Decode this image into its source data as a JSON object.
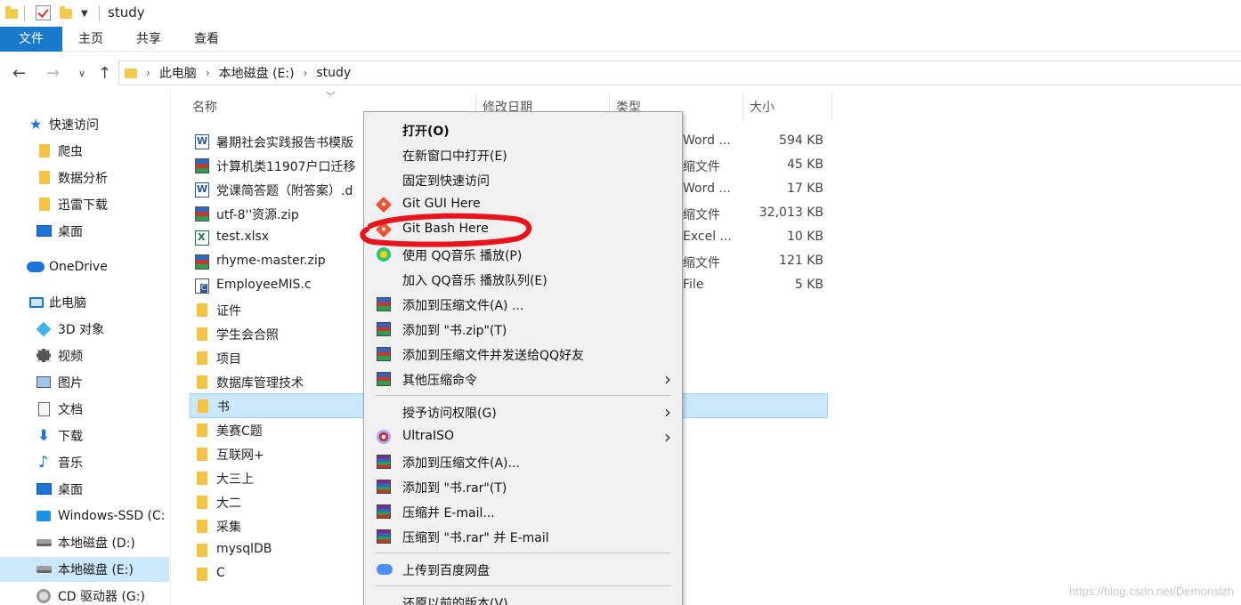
{
  "window": {
    "title": "study"
  },
  "ribbon": {
    "tabs": [
      "文件",
      "主页",
      "共享",
      "查看"
    ]
  },
  "address": {
    "crumbs": [
      "此电脑",
      "本地磁盘 (E:)",
      "study"
    ]
  },
  "sidebar": {
    "items": [
      {
        "label": "快速访问",
        "icon": "star-icon"
      },
      {
        "label": "爬虫",
        "icon": "folder-icon"
      },
      {
        "label": "数据分析",
        "icon": "folder-icon"
      },
      {
        "label": "迅雷下载",
        "icon": "folder-icon"
      },
      {
        "label": "桌面",
        "icon": "desktop-icon"
      },
      {
        "label": "OneDrive",
        "icon": "cloud-icon"
      },
      {
        "label": "此电脑",
        "icon": "computer-icon"
      },
      {
        "label": "3D 对象",
        "icon": "cube-icon"
      },
      {
        "label": "视频",
        "icon": "video-icon"
      },
      {
        "label": "图片",
        "icon": "picture-icon"
      },
      {
        "label": "文档",
        "icon": "document-icon"
      },
      {
        "label": "下载",
        "icon": "download-icon"
      },
      {
        "label": "音乐",
        "icon": "music-icon"
      },
      {
        "label": "桌面",
        "icon": "desktop-icon"
      },
      {
        "label": "Windows-SSD (C:",
        "icon": "windows-drive-icon"
      },
      {
        "label": "本地磁盘 (D:)",
        "icon": "drive-icon"
      },
      {
        "label": "本地磁盘 (E:)",
        "icon": "drive-icon"
      },
      {
        "label": "CD 驱动器 (G:)",
        "icon": "cd-drive-icon"
      }
    ]
  },
  "columns": [
    "名称",
    "修改日期",
    "类型",
    "大小"
  ],
  "files": [
    {
      "name": "暑期社会实践报告书模版",
      "type": "Word ...",
      "size": "594 KB",
      "icon": "word-icon"
    },
    {
      "name": "计算机类11907户口迁移",
      "type": "缩文件",
      "size": "45 KB",
      "icon": "zip-icon"
    },
    {
      "name": "党课简答题（附答案）.d",
      "type": "Word ...",
      "size": "17 KB",
      "icon": "word-icon"
    },
    {
      "name": "utf-8''资源.zip",
      "type": "缩文件",
      "size": "32,013 KB",
      "icon": "zip-icon"
    },
    {
      "name": "test.xlsx",
      "type": "Excel ...",
      "size": "10 KB",
      "icon": "excel-icon"
    },
    {
      "name": "rhyme-master.zip",
      "type": "缩文件",
      "size": "121 KB",
      "icon": "zip-icon"
    },
    {
      "name": "EmployeeMIS.c",
      "type": "File",
      "size": "5 KB",
      "icon": "c-file-icon"
    },
    {
      "name": "证件",
      "type": "",
      "size": "",
      "icon": "folder-icon"
    },
    {
      "name": "学生会合照",
      "type": "",
      "size": "",
      "icon": "folder-icon"
    },
    {
      "name": "项目",
      "type": "",
      "size": "",
      "icon": "folder-icon"
    },
    {
      "name": "数据库管理技术",
      "type": "",
      "size": "",
      "icon": "folder-icon"
    },
    {
      "name": "书",
      "type": "",
      "size": "",
      "icon": "folder-icon"
    },
    {
      "name": "美赛C题",
      "type": "",
      "size": "",
      "icon": "folder-icon"
    },
    {
      "name": "互联网+",
      "type": "",
      "size": "",
      "icon": "folder-icon"
    },
    {
      "name": "大三上",
      "type": "",
      "size": "",
      "icon": "folder-icon"
    },
    {
      "name": "大二",
      "type": "",
      "size": "",
      "icon": "folder-icon"
    },
    {
      "name": "采集",
      "type": "",
      "size": "",
      "icon": "folder-icon"
    },
    {
      "name": "mysqlDB",
      "type": "",
      "size": "",
      "icon": "folder-icon"
    },
    {
      "name": "C",
      "type": "",
      "size": "",
      "icon": "folder-icon"
    }
  ],
  "context_menu": {
    "items": [
      {
        "label": "打开(O)",
        "icon": "",
        "bold": true,
        "submenu": false
      },
      {
        "label": "在新窗口中打开(E)",
        "icon": "",
        "submenu": false
      },
      {
        "label": "固定到快速访问",
        "icon": "",
        "submenu": false
      },
      {
        "label": "Git GUI Here",
        "icon": "git-icon",
        "submenu": false
      },
      {
        "label": "Git Bash Here",
        "icon": "git-icon",
        "submenu": false
      },
      {
        "label": "使用 QQ音乐 播放(P)",
        "icon": "qq-music-icon",
        "submenu": false
      },
      {
        "label": "加入 QQ音乐 播放队列(E)",
        "icon": "",
        "submenu": false
      },
      {
        "label": "添加到压缩文件(A) ...",
        "icon": "winrar-icon",
        "submenu": false
      },
      {
        "label": "添加到 \"书.zip\"(T)",
        "icon": "winrar-icon",
        "submenu": false
      },
      {
        "label": "添加到压缩文件并发送给QQ好友",
        "icon": "winrar-icon",
        "submenu": false
      },
      {
        "label": "其他压缩命令",
        "icon": "winrar-icon",
        "submenu": true
      },
      {
        "label": "授予访问权限(G)",
        "icon": "",
        "submenu": true
      },
      {
        "label": "UltraISO",
        "icon": "ultraiso-icon",
        "submenu": true
      },
      {
        "label": "添加到压缩文件(A)...",
        "icon": "winrar-books-icon",
        "submenu": false
      },
      {
        "label": "添加到 \"书.rar\"(T)",
        "icon": "winrar-books-icon",
        "submenu": false
      },
      {
        "label": "压缩并 E-mail...",
        "icon": "winrar-books-icon",
        "submenu": false
      },
      {
        "label": "压缩到 \"书.rar\" 并 E-mail",
        "icon": "winrar-books-icon",
        "submenu": false
      },
      {
        "label": "上传到百度网盘",
        "icon": "baidu-netdisk-icon",
        "submenu": false
      },
      {
        "label": "还原以前的版本(V)",
        "icon": "",
        "submenu": false
      }
    ]
  },
  "watermark": "https://blog.csdn.net/Demonslzh",
  "colors": {
    "accent": "#1979ca",
    "selection": "#cce8ff",
    "annotation": "#e8131b"
  }
}
